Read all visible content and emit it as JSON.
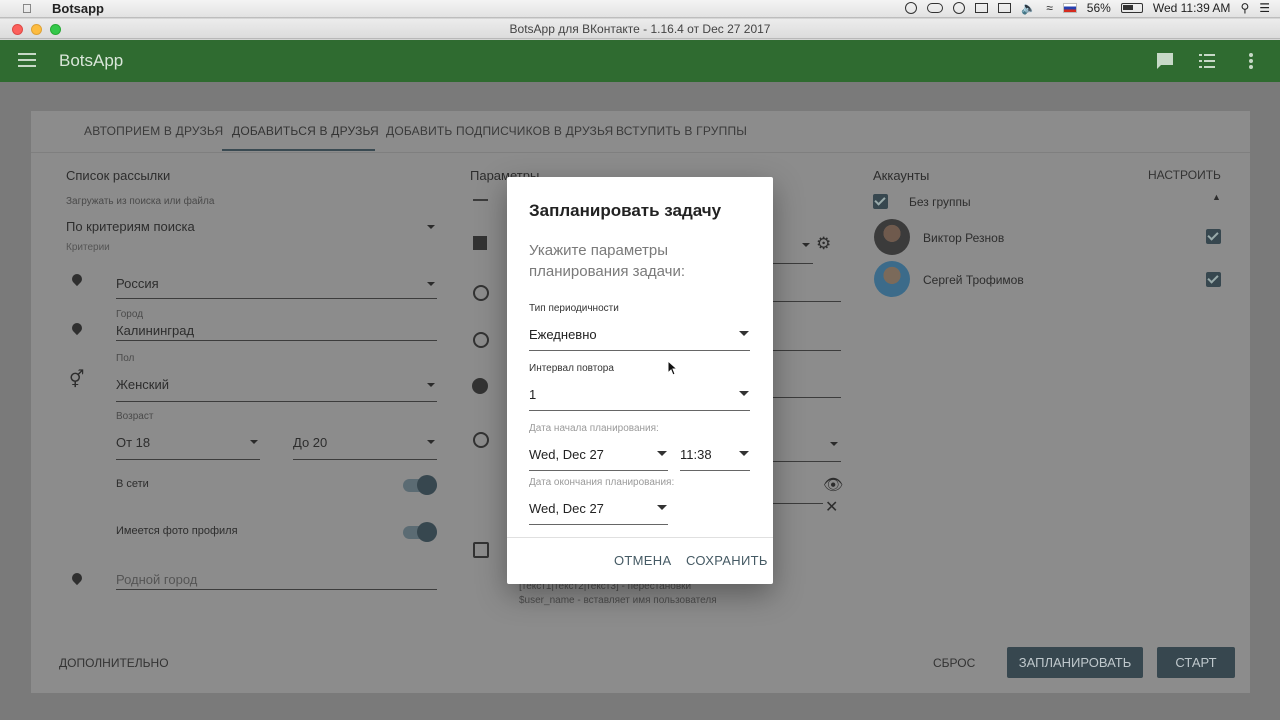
{
  "menubar": {
    "app_name": "Botsapp",
    "battery": "56%",
    "clock": "Wed 11:39 AM"
  },
  "window": {
    "title": "BotsApp для ВКонтакте - 1.16.4 от Dec 27 2017"
  },
  "appbar": {
    "title": "BotsApp"
  },
  "tabs": [
    {
      "label": "АВТОПРИЕМ В ДРУЗЬЯ"
    },
    {
      "label": "ДОБАВИТЬСЯ В ДРУЗЬЯ"
    },
    {
      "label": "ДОБАВИТЬ ПОДПИСЧИКОВ В ДРУЗЬЯ"
    },
    {
      "label": "ВСТУПИТЬ В ГРУППЫ"
    }
  ],
  "mailing": {
    "heading": "Список рассылки",
    "source_label": "Загружать из поиска или файла",
    "source_value": "По критериям поиска",
    "criteria_label": "Критерии",
    "country": "Россия",
    "city_label": "Город",
    "city": "Калининград",
    "sex_label": "Пол",
    "sex": "Женский",
    "age_label": "Возраст",
    "age_from": "От 18",
    "age_to": "До 20",
    "online_label": "В сети",
    "photo_label": "Имеется фото профиля",
    "hometown_placeholder": "Родной город"
  },
  "params": {
    "heading": "Параметры",
    "hint_1": "[текст1|текст2|текст3] - перестановки",
    "hint_2": "$user_name - вставляет имя пользователя"
  },
  "accounts": {
    "heading": "Аккаунты",
    "configure": "НАСТРОИТЬ",
    "group": "Без группы",
    "items": [
      {
        "name": "Виктор Резнов"
      },
      {
        "name": "Сергей Трофимов"
      }
    ]
  },
  "footer": {
    "more": "ДОПОЛНИТЕЛЬНО",
    "reset": "СБРОС",
    "schedule": "ЗАПЛАНИРОВАТЬ",
    "start": "СТАРТ"
  },
  "dialog": {
    "title": "Запланировать задачу",
    "subtitle": "Укажите параметры планирования задачи:",
    "period_label": "Тип периодичности",
    "period_value": "Ежедневно",
    "interval_label": "Интервал повтора",
    "interval_value": "1",
    "start_label": "Дата начала планирования:",
    "start_date": "Wed, Dec 27",
    "start_time": "11:38",
    "end_label": "Дата окончания планирования:",
    "end_date": "Wed, Dec 27",
    "cancel": "ОТМЕНА",
    "save": "СОХРАНИТЬ"
  }
}
